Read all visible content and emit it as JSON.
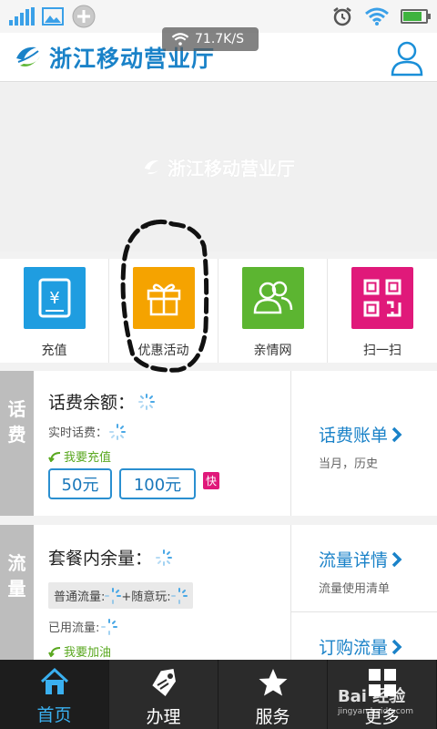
{
  "status": {
    "speed": "71.7K/S"
  },
  "header": {
    "title": "浙江移动营业厅"
  },
  "banner": {
    "text": "浙江移动营业厅"
  },
  "quick_actions": [
    {
      "label": "充值",
      "icon": "wallet-icon",
      "color": "#1f9de0"
    },
    {
      "label": "优惠活动",
      "icon": "gift-icon",
      "color": "#f5a300"
    },
    {
      "label": "亲情网",
      "icon": "family-icon",
      "color": "#5cb531"
    },
    {
      "label": "扫一扫",
      "icon": "qrcode-icon",
      "color": "#e0197a"
    }
  ],
  "fee_card": {
    "side": "话费",
    "balance_label": "话费余额：",
    "realtime_label": "实时话费：",
    "recharge_note": "我要充值",
    "amounts": [
      "50元",
      "100元"
    ],
    "fast_badge": "快",
    "link_title": "话费账单",
    "link_sub": "当月，历史"
  },
  "data_card": {
    "side": "流量",
    "remaining_label": "套餐内余量：",
    "plan_normal": "普通流量:",
    "plan_plus": "+随意玩:",
    "used_label": "已用流量:",
    "topup_note": "我要加油",
    "link1_title": "流量详情",
    "link1_sub": "流量使用清单",
    "link2_title": "订购流量"
  },
  "tabs": [
    {
      "label": "首页",
      "icon": "home-icon",
      "active": true
    },
    {
      "label": "办理",
      "icon": "tag-icon",
      "active": false
    },
    {
      "label": "服务",
      "icon": "star-icon",
      "active": false
    },
    {
      "label": "更多",
      "icon": "grid-icon",
      "active": false
    }
  ],
  "watermark": {
    "main": "Bai 经验",
    "sub": "jingyan.baidu.com"
  },
  "colors": {
    "brand_blue": "#1a82c8",
    "accent_pink": "#e0197a",
    "note_green": "#5aa820"
  }
}
